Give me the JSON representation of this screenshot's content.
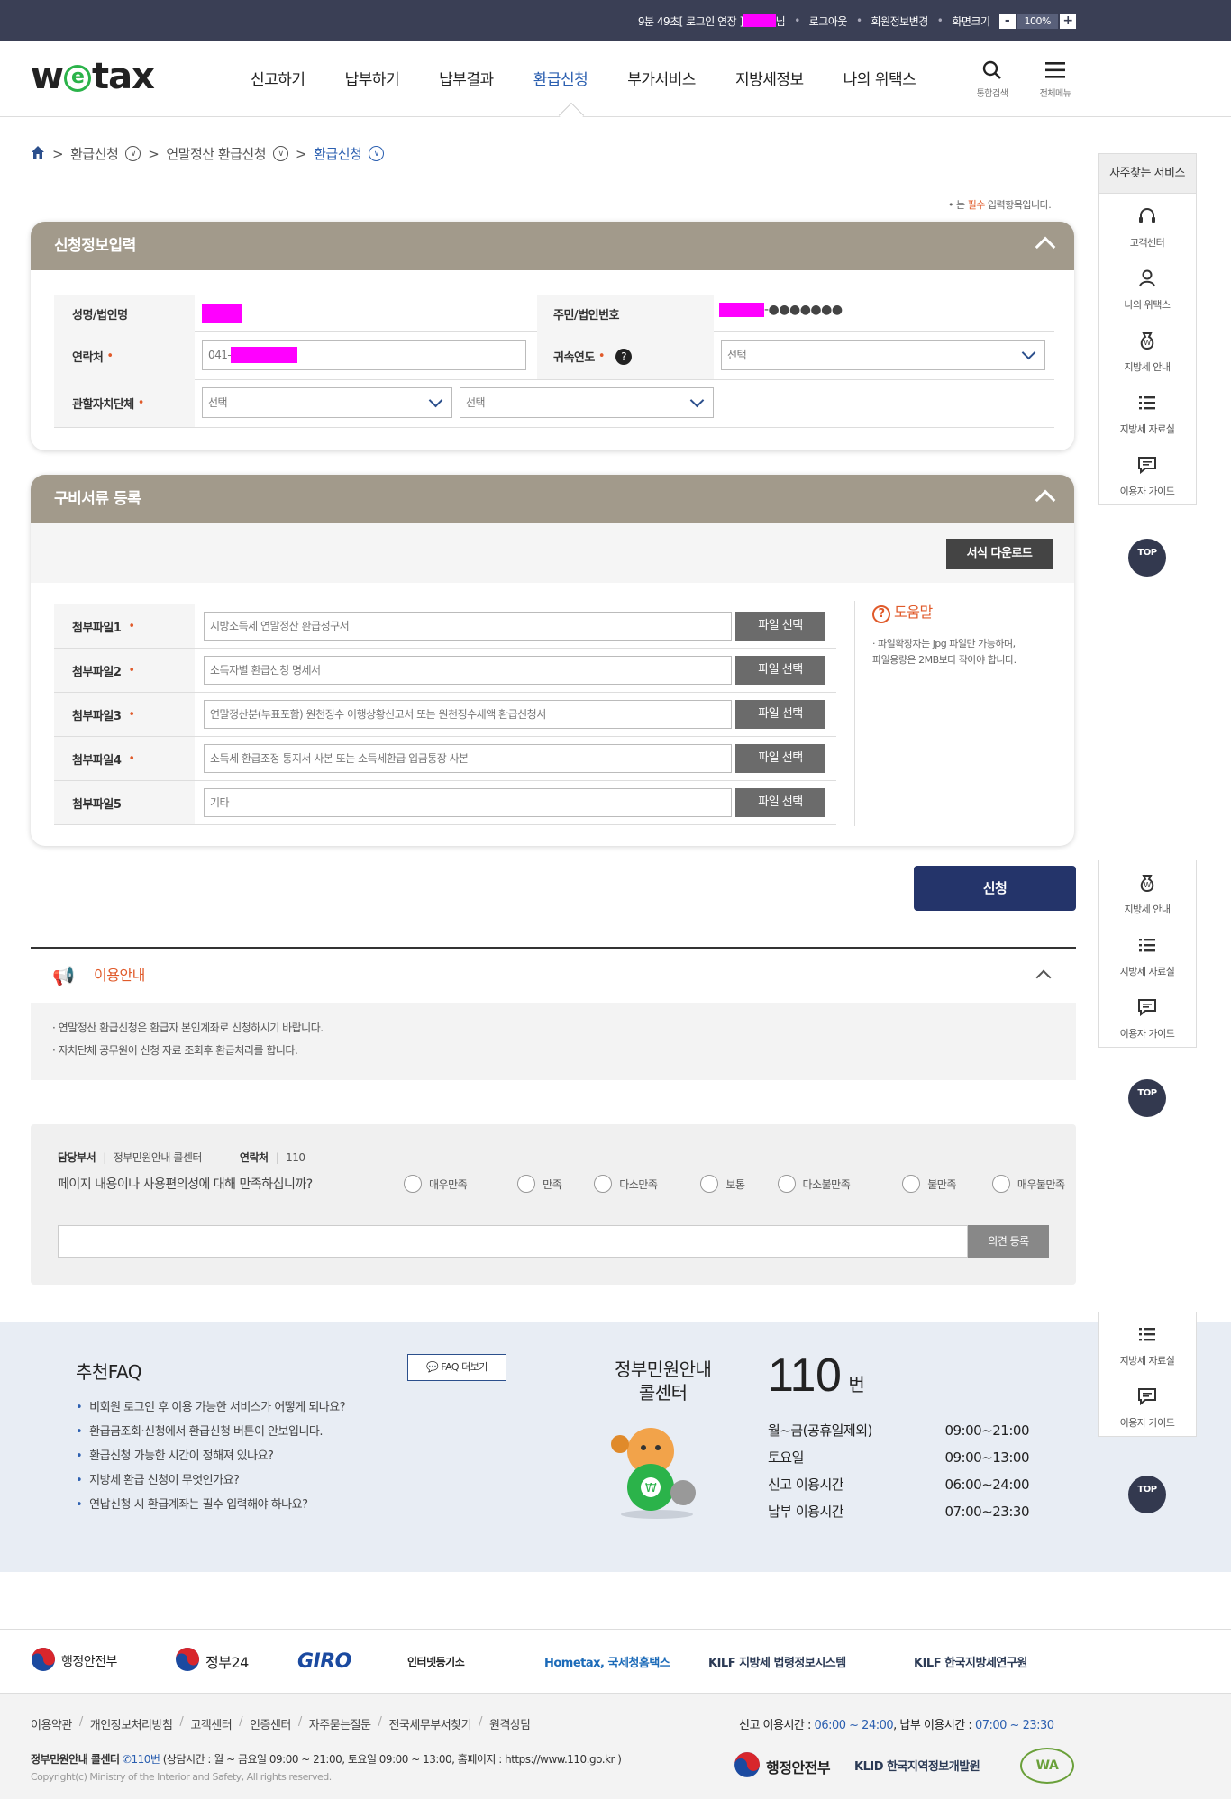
{
  "topbar": {
    "session": "9분 49초[ 로그인 연장 ]",
    "user_suffix": "님",
    "logout": "로그아웃",
    "member_edit": "회원정보변경",
    "screen_size": "화면크기",
    "zoom_minus": "-",
    "zoom_value": "100%",
    "zoom_plus": "+"
  },
  "header": {
    "logo_left": "w",
    "logo_mid": "e",
    "logo_right": "tax",
    "nav": [
      "신고하기",
      "납부하기",
      "납부결과",
      "환급신청",
      "부가서비스",
      "지방세정보",
      "나의 위택스"
    ],
    "search_label": "통합검색",
    "menu_label": "전체메뉴"
  },
  "breadcrumb": {
    "items": [
      "환급신청",
      "연말정산 환급신청",
      "환급신청"
    ]
  },
  "required_note": {
    "prefix": "• 는 ",
    "word": "필수",
    "suffix": " 입력항목입니다."
  },
  "apply_info": {
    "title": "신청정보입력",
    "name_label": "성명/법인명",
    "id_label": "주민/법인번호",
    "id_masked": "-●●●●●●●",
    "contact_label": "연락처",
    "contact_prefix": "041-",
    "year_label": "귀속연도",
    "year_select": "선택",
    "region_label": "관할자치단체",
    "region_select1": "선택",
    "region_select2": "선택"
  },
  "documents": {
    "title": "구비서류 등록",
    "download_button": "서식 다운로드",
    "file_button": "파일 선택",
    "files": [
      {
        "label": "첨부파일1",
        "required": true,
        "placeholder": "지방소득세 연말정산 환급청구서"
      },
      {
        "label": "첨부파일2",
        "required": true,
        "placeholder": "소득자별 환급신청 명세서"
      },
      {
        "label": "첨부파일3",
        "required": true,
        "placeholder": "연말정산분(부표포함) 원천징수 이행상황신고서 또는 원천징수세액 환급신청서"
      },
      {
        "label": "첨부파일4",
        "required": true,
        "placeholder": "소득세 환급조정 통지서 사본 또는 소득세환급 입금통장 사본"
      },
      {
        "label": "첨부파일5",
        "required": false,
        "placeholder": "기타"
      }
    ],
    "help_title": "도움말",
    "help_line1": "· 파일확장자는 jpg 파일만 가능하며,",
    "help_line2": "  파일용량은 2MB보다 작아야 합니다."
  },
  "submit_label": "신청",
  "guide": {
    "title": "이용안내",
    "lines": [
      "· 연말정산 환급신청은 환급자 본인계좌로 신청하시기 바랍니다.",
      "· 자치단체 공무원이 신청 자료 조회후 환급처리를 합니다."
    ]
  },
  "survey": {
    "dept_label": "담당부서",
    "dept": "정부민원안내 콜센터",
    "contact_label": "연락처",
    "contact": "110",
    "question": "페이지 내용이나 사용편의성에 대해 만족하십니까?",
    "options": [
      "매우만족",
      "만족",
      "다소만족",
      "보통",
      "다소불만족",
      "불만족",
      "매우불만족"
    ],
    "submit": "의견 등록"
  },
  "faq": {
    "title": "추천FAQ",
    "more": "FAQ 더보기",
    "items": [
      "비회원 로그인 후 이용 가능한 서비스가 어떻게 되나요?",
      "환급금조회·신청에서 환급신청 버튼이 안보입니다.",
      "환급신청 가능한 시간이 정해져 있나요?",
      "지방세 환급 신청이 무엇인가요?",
      "연납신청 시 환급계좌는 필수 입력해야 하나요?"
    ]
  },
  "callcenter": {
    "title1": "정부민원안내",
    "title2": "콜센터",
    "number": "110",
    "unit": "번",
    "hours": [
      {
        "label": "월~금(공휴일제외)",
        "time": "09:00~21:00"
      },
      {
        "label": "토요일",
        "time": "09:00~13:00"
      },
      {
        "label": "신고 이용시간",
        "time": "06:00~24:00"
      },
      {
        "label": "납부 이용시간",
        "time": "07:00~23:30"
      }
    ]
  },
  "partners": [
    "행정안전부",
    "정부24",
    "GIRO",
    "인터넷등기소",
    "Hometax, 국세청홈택스",
    "KILF 지방세 법령정보시스템",
    "KILF 한국지방세연구원"
  ],
  "footer": {
    "links": [
      "이용약관",
      "개인정보처리방침",
      "고객센터",
      "인증센터",
      "자주묻는질문",
      "전국세무부서찾기",
      "원격상담"
    ],
    "time_prefix": "신고 이용시간 : ",
    "time_report": "06:00 ~ 24:00",
    "time_mid": ", 납부 이용시간 : ",
    "time_pay": "07:00 ~ 23:30",
    "center": "정부민원안내 콜센터",
    "center_num": "110번",
    "center_info": "(상담시간 : 월 ~ 금요일 09:00 ~ 21:00, 토요일 09:00 ~ 13:00, 홈페이지 : https://www.110.go.kr )",
    "copyright": "Copyright(c) Ministry of the Interior and Safety, All rights reserved.",
    "logo1": "행정안전부",
    "logo2": "KLID 한국지역정보개발원",
    "logo3": "WA"
  },
  "quick": {
    "title": "자주찾는 서비스",
    "items": [
      {
        "icon": "headset-icon",
        "label": "고객센터"
      },
      {
        "icon": "person-icon",
        "label": "나의 위택스"
      },
      {
        "icon": "moneybag-icon",
        "label": "지방세 안내"
      },
      {
        "icon": "list-icon",
        "label": "지방세 자료실"
      },
      {
        "icon": "chat-icon",
        "label": "이용자 가이드"
      }
    ],
    "top": "TOP"
  }
}
